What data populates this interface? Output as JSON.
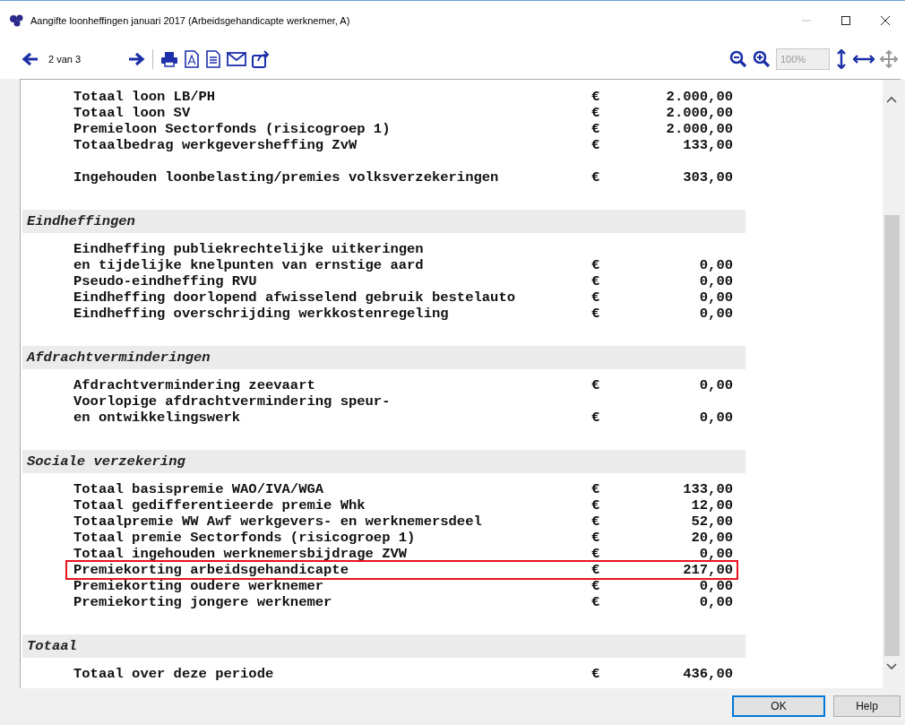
{
  "window": {
    "title": "Aangifte loonheffingen januari 2017 (Arbeidsgehandicapte werknemer, A)"
  },
  "toolbar": {
    "page_field": {
      "value": "2 van 3"
    },
    "zoom_field": {
      "value": "100%",
      "disabled": true
    }
  },
  "report": {
    "sections": [
      {
        "groups": [
          [
            {
              "lines": [
                "Totaal loon LB/PH"
              ],
              "currency": "€",
              "amount": "2.000,00",
              "highlighted": false
            },
            {
              "lines": [
                "Totaal loon SV"
              ],
              "currency": "€",
              "amount": "2.000,00",
              "highlighted": false
            },
            {
              "lines": [
                "Premieloon Sectorfonds (risicogroep 1)"
              ],
              "currency": "€",
              "amount": "2.000,00",
              "highlighted": false
            },
            {
              "lines": [
                "Totaalbedrag werkgeversheffing ZvW"
              ],
              "currency": "€",
              "amount": "133,00",
              "highlighted": false
            }
          ],
          [
            {
              "lines": [
                "Ingehouden loonbelasting/premies volksverzekeringen"
              ],
              "currency": "€",
              "amount": "303,00",
              "highlighted": false
            }
          ]
        ]
      },
      {
        "heading": "Eindheffingen",
        "groups": [
          [
            {
              "lines": [
                "Eindheffing publiekrechtelijke uitkeringen",
                "en tijdelijke knelpunten van ernstige aard"
              ],
              "currency": "€",
              "amount": "0,00",
              "highlighted": false
            },
            {
              "lines": [
                "Pseudo-eindheffing RVU"
              ],
              "currency": "€",
              "amount": "0,00",
              "highlighted": false
            },
            {
              "lines": [
                "Eindheffing doorlopend afwisselend gebruik bestelauto"
              ],
              "currency": "€",
              "amount": "0,00",
              "highlighted": false
            },
            {
              "lines": [
                "Eindheffing overschrijding werkkostenregeling"
              ],
              "currency": "€",
              "amount": "0,00",
              "highlighted": false
            }
          ]
        ]
      },
      {
        "heading": "Afdrachtverminderingen",
        "groups": [
          [
            {
              "lines": [
                "Afdrachtvermindering zeevaart"
              ],
              "currency": "€",
              "amount": "0,00",
              "highlighted": false
            },
            {
              "lines": [
                "Voorlopige afdrachtvermindering speur-",
                "en ontwikkelingswerk"
              ],
              "currency": "€",
              "amount": "0,00",
              "highlighted": false
            }
          ]
        ]
      },
      {
        "heading": "Sociale verzekering",
        "groups": [
          [
            {
              "lines": [
                "Totaal basispremie WAO/IVA/WGA"
              ],
              "currency": "€",
              "amount": "133,00",
              "highlighted": false
            },
            {
              "lines": [
                "Totaal gedifferentieerde premie Whk"
              ],
              "currency": "€",
              "amount": "12,00",
              "highlighted": false
            },
            {
              "lines": [
                "Totaalpremie WW Awf werkgevers- en werknemersdeel"
              ],
              "currency": "€",
              "amount": "52,00",
              "highlighted": false
            },
            {
              "lines": [
                "Totaal premie Sectorfonds (risicogroep 1)"
              ],
              "currency": "€",
              "amount": "20,00",
              "highlighted": false
            },
            {
              "lines": [
                "Totaal ingehouden werknemersbijdrage ZVW"
              ],
              "currency": "€",
              "amount": "0,00",
              "highlighted": false
            },
            {
              "lines": [
                "Premiekorting arbeidsgehandicapte"
              ],
              "currency": "€",
              "amount": "217,00",
              "highlighted": true
            },
            {
              "lines": [
                "Premiekorting oudere werknemer"
              ],
              "currency": "€",
              "amount": "0,00",
              "highlighted": false
            },
            {
              "lines": [
                "Premiekorting jongere werknemer"
              ],
              "currency": "€",
              "amount": "0,00",
              "highlighted": false
            }
          ]
        ]
      },
      {
        "heading": "Totaal",
        "groups": [
          [
            {
              "lines": [
                "Totaal over deze periode"
              ],
              "currency": "€",
              "amount": "436,00",
              "highlighted": false
            }
          ]
        ]
      }
    ]
  },
  "buttons": [
    {
      "label": "OK",
      "default": true
    },
    {
      "label": "Help",
      "default": false
    }
  ]
}
